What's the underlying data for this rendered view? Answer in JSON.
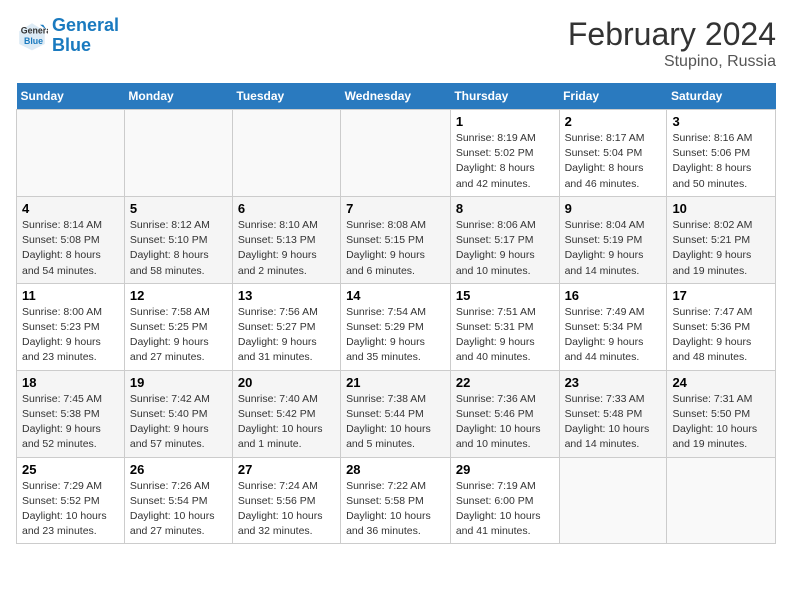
{
  "logo": {
    "line1": "General",
    "line2": "Blue"
  },
  "title": "February 2024",
  "subtitle": "Stupino, Russia",
  "days_of_week": [
    "Sunday",
    "Monday",
    "Tuesday",
    "Wednesday",
    "Thursday",
    "Friday",
    "Saturday"
  ],
  "weeks": [
    [
      {
        "day": "",
        "info": ""
      },
      {
        "day": "",
        "info": ""
      },
      {
        "day": "",
        "info": ""
      },
      {
        "day": "",
        "info": ""
      },
      {
        "day": "1",
        "info": "Sunrise: 8:19 AM\nSunset: 5:02 PM\nDaylight: 8 hours and 42 minutes."
      },
      {
        "day": "2",
        "info": "Sunrise: 8:17 AM\nSunset: 5:04 PM\nDaylight: 8 hours and 46 minutes."
      },
      {
        "day": "3",
        "info": "Sunrise: 8:16 AM\nSunset: 5:06 PM\nDaylight: 8 hours and 50 minutes."
      }
    ],
    [
      {
        "day": "4",
        "info": "Sunrise: 8:14 AM\nSunset: 5:08 PM\nDaylight: 8 hours and 54 minutes."
      },
      {
        "day": "5",
        "info": "Sunrise: 8:12 AM\nSunset: 5:10 PM\nDaylight: 8 hours and 58 minutes."
      },
      {
        "day": "6",
        "info": "Sunrise: 8:10 AM\nSunset: 5:13 PM\nDaylight: 9 hours and 2 minutes."
      },
      {
        "day": "7",
        "info": "Sunrise: 8:08 AM\nSunset: 5:15 PM\nDaylight: 9 hours and 6 minutes."
      },
      {
        "day": "8",
        "info": "Sunrise: 8:06 AM\nSunset: 5:17 PM\nDaylight: 9 hours and 10 minutes."
      },
      {
        "day": "9",
        "info": "Sunrise: 8:04 AM\nSunset: 5:19 PM\nDaylight: 9 hours and 14 minutes."
      },
      {
        "day": "10",
        "info": "Sunrise: 8:02 AM\nSunset: 5:21 PM\nDaylight: 9 hours and 19 minutes."
      }
    ],
    [
      {
        "day": "11",
        "info": "Sunrise: 8:00 AM\nSunset: 5:23 PM\nDaylight: 9 hours and 23 minutes."
      },
      {
        "day": "12",
        "info": "Sunrise: 7:58 AM\nSunset: 5:25 PM\nDaylight: 9 hours and 27 minutes."
      },
      {
        "day": "13",
        "info": "Sunrise: 7:56 AM\nSunset: 5:27 PM\nDaylight: 9 hours and 31 minutes."
      },
      {
        "day": "14",
        "info": "Sunrise: 7:54 AM\nSunset: 5:29 PM\nDaylight: 9 hours and 35 minutes."
      },
      {
        "day": "15",
        "info": "Sunrise: 7:51 AM\nSunset: 5:31 PM\nDaylight: 9 hours and 40 minutes."
      },
      {
        "day": "16",
        "info": "Sunrise: 7:49 AM\nSunset: 5:34 PM\nDaylight: 9 hours and 44 minutes."
      },
      {
        "day": "17",
        "info": "Sunrise: 7:47 AM\nSunset: 5:36 PM\nDaylight: 9 hours and 48 minutes."
      }
    ],
    [
      {
        "day": "18",
        "info": "Sunrise: 7:45 AM\nSunset: 5:38 PM\nDaylight: 9 hours and 52 minutes."
      },
      {
        "day": "19",
        "info": "Sunrise: 7:42 AM\nSunset: 5:40 PM\nDaylight: 9 hours and 57 minutes."
      },
      {
        "day": "20",
        "info": "Sunrise: 7:40 AM\nSunset: 5:42 PM\nDaylight: 10 hours and 1 minute."
      },
      {
        "day": "21",
        "info": "Sunrise: 7:38 AM\nSunset: 5:44 PM\nDaylight: 10 hours and 5 minutes."
      },
      {
        "day": "22",
        "info": "Sunrise: 7:36 AM\nSunset: 5:46 PM\nDaylight: 10 hours and 10 minutes."
      },
      {
        "day": "23",
        "info": "Sunrise: 7:33 AM\nSunset: 5:48 PM\nDaylight: 10 hours and 14 minutes."
      },
      {
        "day": "24",
        "info": "Sunrise: 7:31 AM\nSunset: 5:50 PM\nDaylight: 10 hours and 19 minutes."
      }
    ],
    [
      {
        "day": "25",
        "info": "Sunrise: 7:29 AM\nSunset: 5:52 PM\nDaylight: 10 hours and 23 minutes."
      },
      {
        "day": "26",
        "info": "Sunrise: 7:26 AM\nSunset: 5:54 PM\nDaylight: 10 hours and 27 minutes."
      },
      {
        "day": "27",
        "info": "Sunrise: 7:24 AM\nSunset: 5:56 PM\nDaylight: 10 hours and 32 minutes."
      },
      {
        "day": "28",
        "info": "Sunrise: 7:22 AM\nSunset: 5:58 PM\nDaylight: 10 hours and 36 minutes."
      },
      {
        "day": "29",
        "info": "Sunrise: 7:19 AM\nSunset: 6:00 PM\nDaylight: 10 hours and 41 minutes."
      },
      {
        "day": "",
        "info": ""
      },
      {
        "day": "",
        "info": ""
      }
    ]
  ]
}
